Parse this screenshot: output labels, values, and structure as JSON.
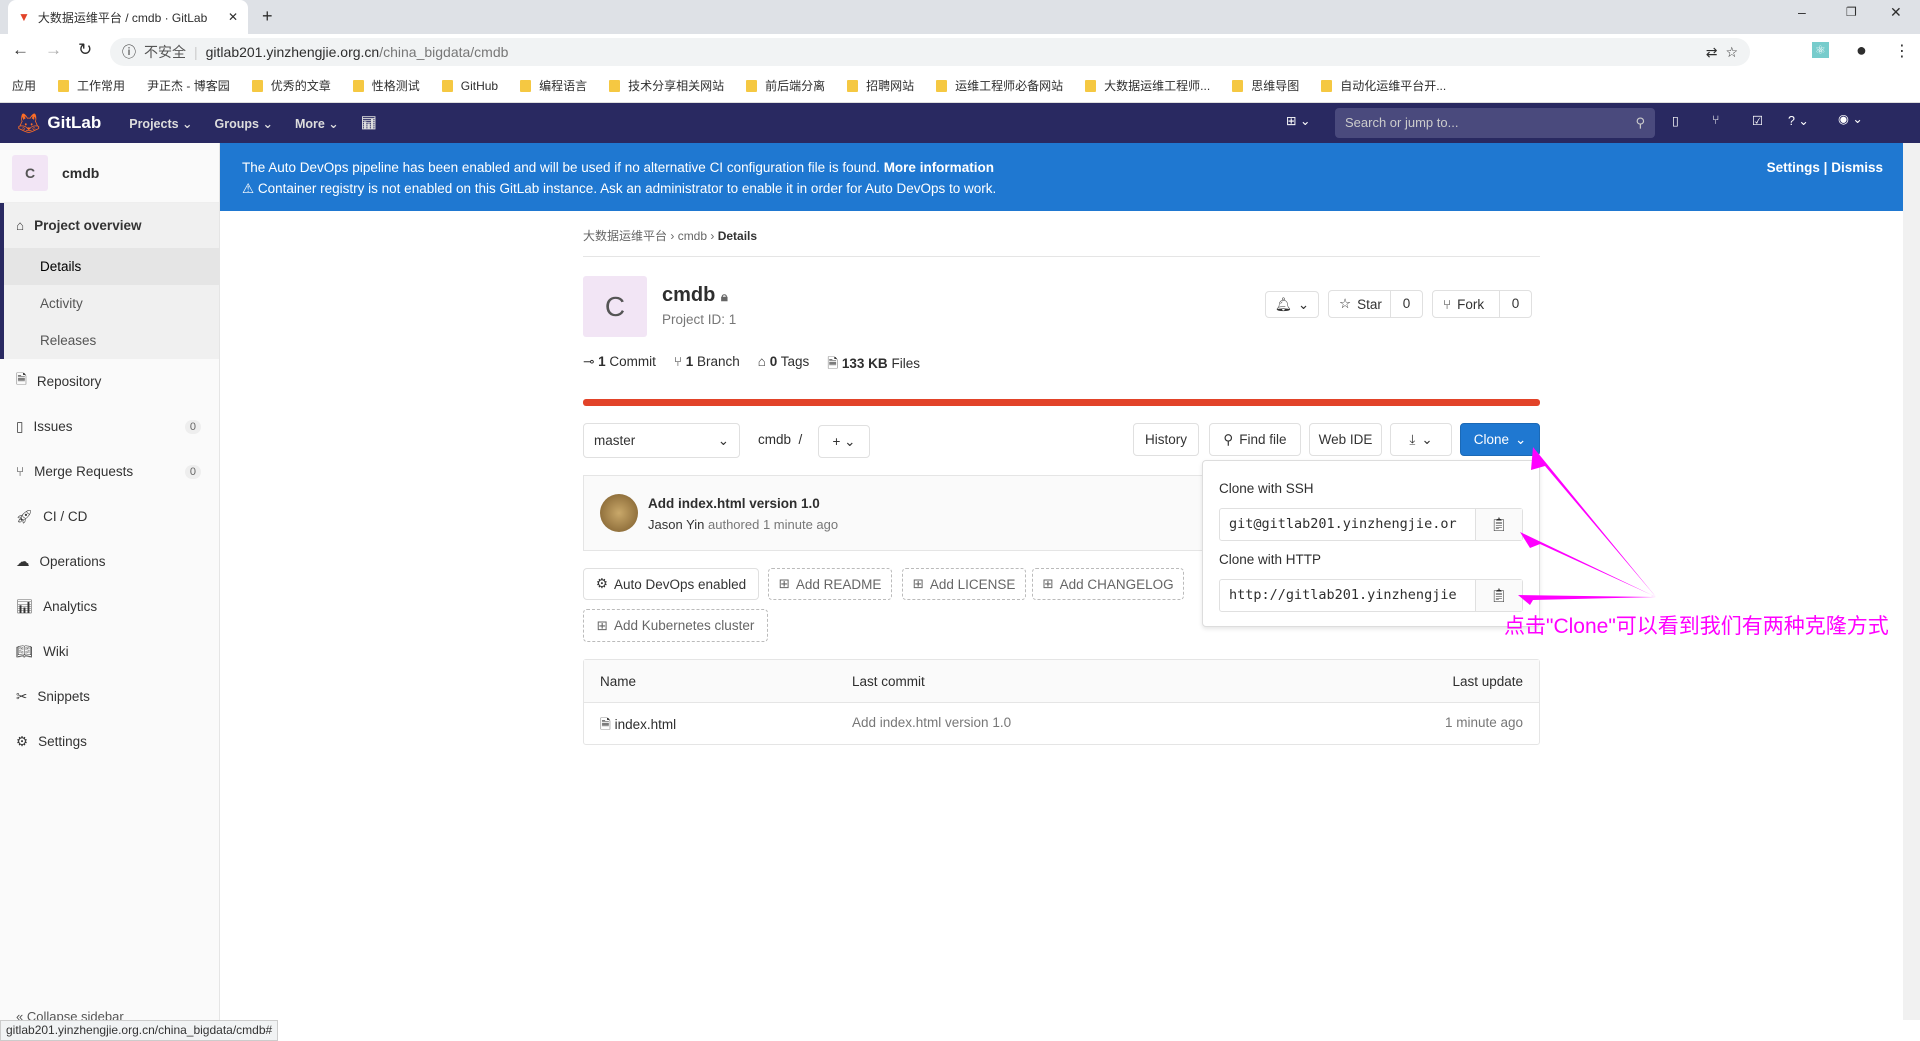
{
  "browser": {
    "tab_title": "大数据运维平台 / cmdb · GitLab",
    "security": "不安全",
    "url_host": "gitlab201.yinzhengjie.org.cn",
    "url_path": "/china_bigdata/cmdb",
    "bookmarks": [
      "应用",
      "工作常用",
      "尹正杰 - 博客园",
      "优秀的文章",
      "性格测试",
      "GitHub",
      "编程语言",
      "技术分享相关网站",
      "前后端分离",
      "招聘网站",
      "运维工程师必备网站",
      "大数据运维工程师...",
      "思维导图",
      "自动化运维平台开..."
    ]
  },
  "nav": {
    "brand": "GitLab",
    "projects": "Projects",
    "groups": "Groups",
    "more": "More",
    "search_placeholder": "Search or jump to..."
  },
  "sidebar": {
    "project_initial": "C",
    "project_name": "cmdb",
    "overview": "Project overview",
    "sub": [
      "Details",
      "Activity",
      "Releases"
    ],
    "items": [
      {
        "label": "Repository"
      },
      {
        "label": "Issues",
        "count": "0"
      },
      {
        "label": "Merge Requests",
        "count": "0"
      },
      {
        "label": "CI / CD"
      },
      {
        "label": "Operations"
      },
      {
        "label": "Analytics"
      },
      {
        "label": "Wiki"
      },
      {
        "label": "Snippets"
      },
      {
        "label": "Settings"
      }
    ],
    "collapse": "Collapse sidebar"
  },
  "banner": {
    "line1": "The Auto DevOps pipeline has been enabled and will be used if no alternative CI configuration file is found.",
    "more": "More information",
    "line2": "Container registry is not enabled on this GitLab instance. Ask an administrator to enable it in order for Auto DevOps to work.",
    "settings": "Settings",
    "sep": "|",
    "dismiss": "Dismiss"
  },
  "breadcrumb": [
    "大数据运维平台",
    "cmdb",
    "Details"
  ],
  "project": {
    "initial": "C",
    "name": "cmdb",
    "id_label": "Project ID: 1",
    "star": "Star",
    "star_count": "0",
    "fork": "Fork",
    "fork_count": "0",
    "stats": [
      {
        "n": "1",
        "l": "Commit"
      },
      {
        "n": "1",
        "l": "Branch"
      },
      {
        "n": "0",
        "l": "Tags"
      },
      {
        "n": "133 KB",
        "l": "Files"
      }
    ]
  },
  "repo": {
    "branch": "master",
    "path": "cmdb",
    "sep": "/",
    "history": "History",
    "find_file": "Find file",
    "web_ide": "Web IDE",
    "clone": "Clone"
  },
  "commit": {
    "title": "Add index.html version 1.0",
    "author": "Jason Yin",
    "authored": "authored",
    "time": "1 minute ago"
  },
  "actions": [
    "Auto DevOps enabled",
    "Add README",
    "Add LICENSE",
    "Add CHANGELOG",
    "Add Kubernetes cluster"
  ],
  "clone_menu": {
    "ssh_label": "Clone with SSH",
    "ssh_url": "git@gitlab201.yinzhengjie.or",
    "http_label": "Clone with HTTP",
    "http_url": "http://gitlab201.yinzhengjie"
  },
  "table": {
    "headers": [
      "Name",
      "Last commit",
      "Last update"
    ],
    "rows": [
      {
        "name": "index.html",
        "commit": "Add index.html version 1.0",
        "update": "1 minute ago"
      }
    ]
  },
  "annotation": "点击\"Clone\"可以看到我们有两种克隆方式",
  "status_url": "gitlab201.yinzhengjie.org.cn/china_bigdata/cmdb#",
  "colors": {
    "nav": "#292961",
    "banner": "#1f78d1",
    "clone": "#1f78d1",
    "progress": "#e24329",
    "annotation": "#ff00ff"
  }
}
